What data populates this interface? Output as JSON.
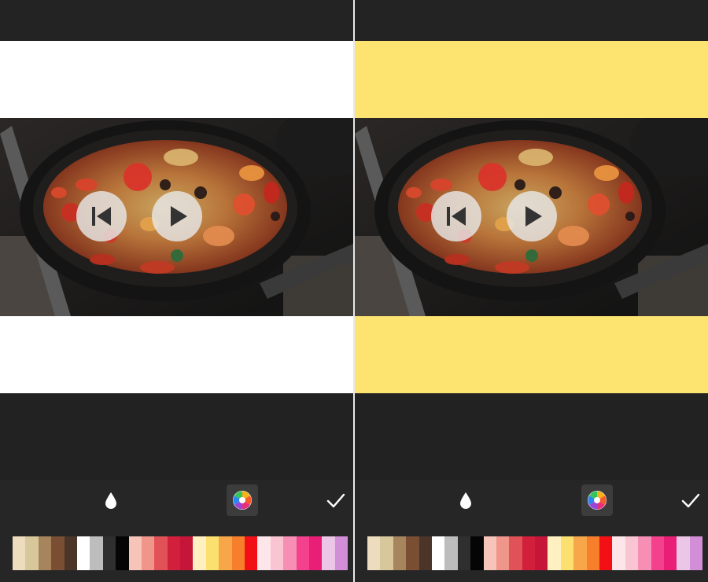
{
  "panels": [
    {
      "id": "left",
      "background_color": "#ffffff",
      "selected_tool": "color-wheel"
    },
    {
      "id": "right",
      "background_color": "#fde470",
      "selected_tool": "color-wheel"
    }
  ],
  "player": {
    "restart_icon": "skip-to-start-icon",
    "play_icon": "play-icon"
  },
  "toolbar": {
    "tools": [
      "eyedropper-drop-icon",
      "color-wheel-icon",
      "checkmark-icon"
    ]
  },
  "palette": [
    "#eedcbf",
    "#d8c79a",
    "#a6855c",
    "#7a4e33",
    "#4a3528",
    "#ffffff",
    "#bdbdbd",
    "#2f2f2f",
    "#050505",
    "#f6c4b9",
    "#f0958a",
    "#e15158",
    "#d11f3c",
    "#c5163a",
    "#fff0c2",
    "#fbe06f",
    "#f7a74a",
    "#f77f2c",
    "#f20f16",
    "#fde6ea",
    "#f9c5d3",
    "#f78fb4",
    "#f3418e",
    "#e91e77",
    "#ecc6e6",
    "#d28ed6"
  ]
}
